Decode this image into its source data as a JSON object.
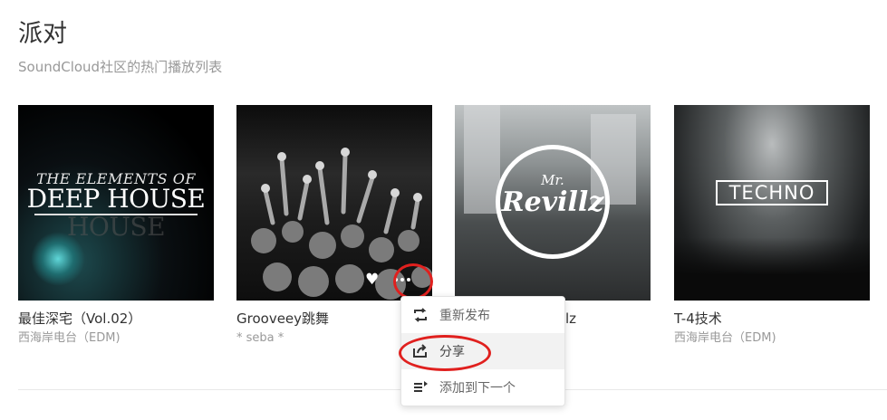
{
  "header": {
    "title": "派对",
    "subtitle": "SoundCloud社区的热门播放列表"
  },
  "cards": [
    {
      "title": "最佳深宅（Vol.02）",
      "artist": "西海岸电台（EDM)",
      "art_text": [
        "THE ELEMENTS OF",
        "DEEP HOUSE",
        "HOUSE"
      ]
    },
    {
      "title": "Grooveey跳舞",
      "artist": "* seba *"
    },
    {
      "title_visible": "lz",
      "art_text": [
        "Mr.",
        "Revillz"
      ]
    },
    {
      "title": "T-4技术",
      "artist": "西海岸电台（EDM)",
      "art_text": [
        "TECHNO"
      ]
    }
  ],
  "menu": {
    "items": [
      {
        "label": "重新发布",
        "icon": "repost-icon"
      },
      {
        "label": "分享",
        "icon": "share-icon"
      },
      {
        "label": "添加到下一个",
        "icon": "add-to-next-up-icon"
      }
    ]
  },
  "colors": {
    "highlight_ring": "#e0201e",
    "subtitle_gray": "#999999"
  }
}
